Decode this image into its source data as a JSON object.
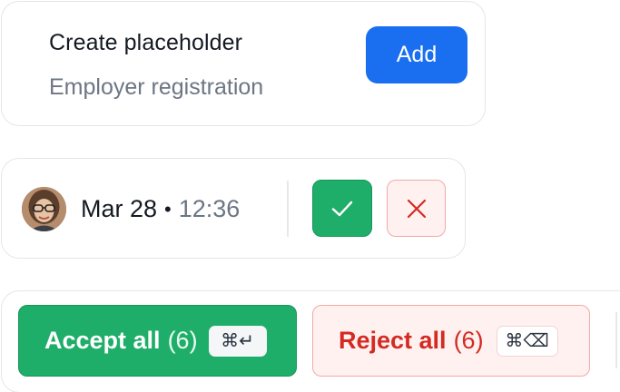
{
  "placeholder_card": {
    "title": "Create placeholder",
    "subtitle": "Employer registration",
    "add_label": "Add"
  },
  "change_row": {
    "avatar": "avatar-photo",
    "date": "Mar 28",
    "separator": "•",
    "time": "12:36",
    "accept_icon": "check-icon",
    "reject_icon": "close-icon"
  },
  "bulk_bar": {
    "accept_label": "Accept all",
    "accept_count": "(6)",
    "accept_shortcut": "⌘↵",
    "reject_label": "Reject all",
    "reject_count": "(6)",
    "reject_shortcut": "⌘⌫"
  },
  "colors": {
    "primary": "#1a6ff0",
    "accept": "#1fae69",
    "reject": "#d42a22",
    "reject_bg": "#fff1f0"
  }
}
